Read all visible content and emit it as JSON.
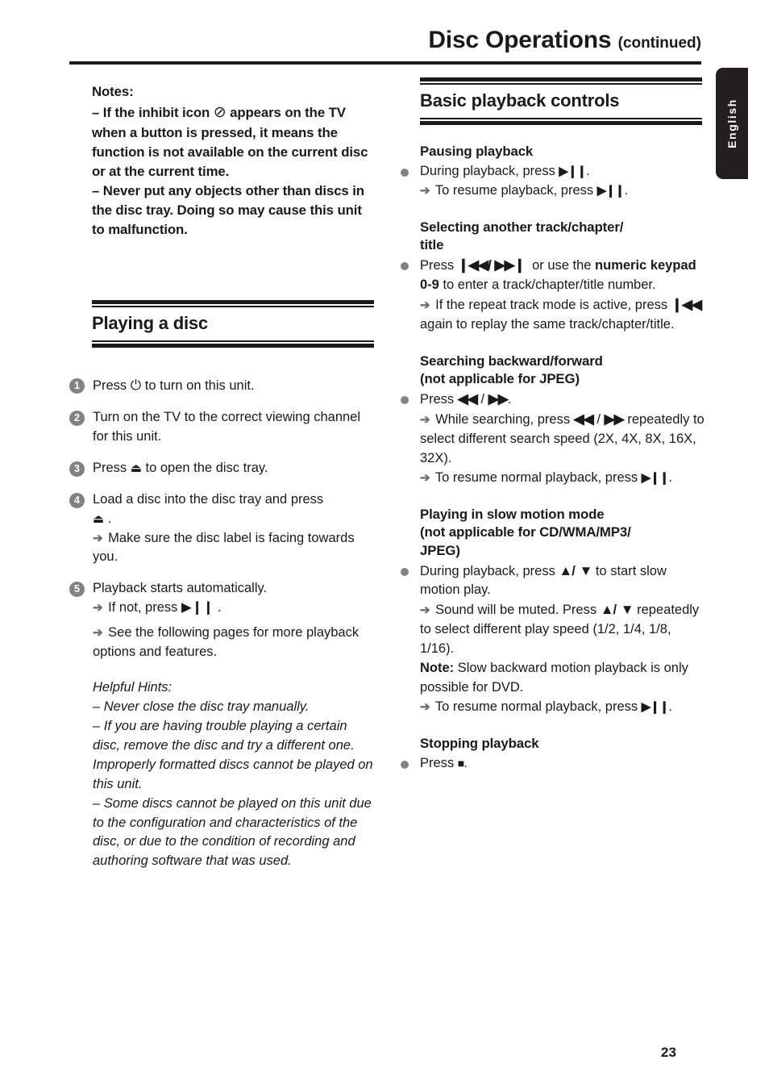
{
  "header": {
    "title": "Disc Operations",
    "continued": "(continued)"
  },
  "language_tab": {
    "label": "English"
  },
  "page_number": "23",
  "icons": {
    "inhibit": "⊘",
    "power": "⏻",
    "eject": "⏏",
    "play_pause": "▶❙❙",
    "prev_track": "❙◀◀",
    "next_track": "▶▶❙",
    "rewind": "◀◀",
    "fast_forward": "▶▶",
    "up": "▲",
    "down": "▼",
    "stop": "■",
    "arrow": "➔"
  },
  "left_column": {
    "notes": {
      "title": "Notes:",
      "items": [
        {
          "lead": "–",
          "before_icon": "If the  inhibit icon",
          "after_icon": "appears on the TV when a button is pressed, it means the function is not available on the current disc or at the current time."
        },
        {
          "lead": "–",
          "text": "Never put any objects other than discs in the disc tray. Doing so may cause this unit to malfunction."
        }
      ]
    },
    "section": {
      "heading": "Playing a disc",
      "steps": [
        {
          "num": "1",
          "parts": [
            "Press ",
            "ICON:power",
            " to turn on this unit."
          ]
        },
        {
          "num": "2",
          "parts": [
            "Turn on the TV to the correct viewing channel for this unit."
          ]
        },
        {
          "num": "3",
          "parts": [
            "Press ",
            "ICON:eject",
            " to open the disc tray."
          ]
        },
        {
          "num": "4",
          "parts": [
            "Load a disc into the disc tray and press ",
            "ICON:eject",
            " ."
          ],
          "results": [
            "Make sure the disc label is facing towards you."
          ]
        },
        {
          "num": "5",
          "parts": [
            "Playback starts automatically."
          ],
          "results": [
            "If not, press ▶❙❙ .",
            "See the following pages for more playback options and features."
          ]
        }
      ]
    },
    "helpful_hints": {
      "title": "Helpful Hints:",
      "items": [
        "–  Never close the disc tray manually.",
        "–  If you are having trouble playing a certain disc, remove the disc and try a different one. Improperly formatted discs cannot be played on this unit.",
        "–  Some discs cannot be played on this unit due to the configuration and characteristics of the disc, or due to the condition of recording and authoring software that was used."
      ]
    }
  },
  "right_column": {
    "section_heading": "Basic playback controls",
    "topics": [
      {
        "heading": "Pausing playback",
        "bullet": "During playback, press ▶❙❙ .",
        "results": [
          "To resume playback, press ▶❙❙ ."
        ]
      },
      {
        "heading": "Selecting another track/chapter/ title",
        "bullet_pre": "Press ",
        "bullet_icons": "❙◀◀ / ▶▶❙",
        "bullet_mid": " or use the ",
        "bullet_bold": "numeric keypad 0-9",
        "bullet_post": " to enter a track/chapter/title number.",
        "results": [
          "If the repeat track mode is active, press ❙◀◀ again to replay the same track/chapter/title."
        ]
      },
      {
        "heading": "Searching backward/forward (not applicable for JPEG)",
        "bullet": "Press ◀◀ / ▶▶.",
        "results": [
          "While searching, press ◀◀ / ▶▶ repeatedly to select different search speed (2X, 4X, 8X, 16X, 32X).",
          "To resume normal playback, press ▶❙❙ ."
        ]
      },
      {
        "heading": "Playing in slow motion mode (not applicable for CD/WMA/MP3/ JPEG)",
        "bullet": "During playback, press ▲/ ▼ to start slow motion play.",
        "results": [
          "Sound will be muted. Press ▲/ ▼ repeatedly to select different play speed (1/2, 1/4, 1/8, 1/16).",
          "To resume normal playback, press ▶❙❙ ."
        ],
        "note_label": "Note:",
        "note_text": " Slow backward motion playback is only possible for DVD."
      },
      {
        "heading": "Stopping playback",
        "bullet": "Press ■."
      }
    ]
  }
}
